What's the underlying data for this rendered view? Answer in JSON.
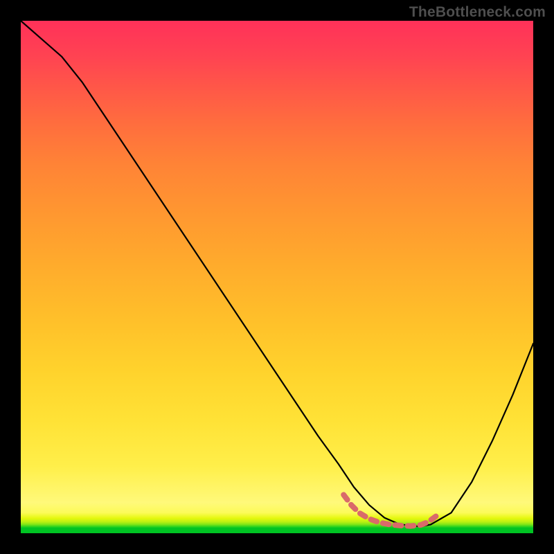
{
  "watermark": "TheBottleneck.com",
  "chart_data": {
    "type": "line",
    "title": "",
    "xlabel": "",
    "ylabel": "",
    "categories": [],
    "x": [
      0.0,
      0.04,
      0.08,
      0.12,
      0.18,
      0.25,
      0.3,
      0.4,
      0.5,
      0.58,
      0.62,
      0.65,
      0.68,
      0.71,
      0.74,
      0.78,
      0.8,
      0.84,
      0.88,
      0.92,
      0.96,
      1.0
    ],
    "values": [
      1.0,
      0.965,
      0.93,
      0.88,
      0.79,
      0.685,
      0.61,
      0.46,
      0.31,
      0.19,
      0.135,
      0.09,
      0.055,
      0.03,
      0.017,
      0.013,
      0.017,
      0.04,
      0.1,
      0.18,
      0.27,
      0.37
    ],
    "xlim": [
      0,
      1
    ],
    "ylim": [
      0,
      1
    ],
    "series": [
      {
        "name": "bottleneck-curve",
        "x": [
          0.0,
          0.04,
          0.08,
          0.12,
          0.18,
          0.25,
          0.3,
          0.4,
          0.5,
          0.58,
          0.62,
          0.65,
          0.68,
          0.71,
          0.74,
          0.78,
          0.8,
          0.84,
          0.88,
          0.92,
          0.96,
          1.0
        ],
        "y": [
          1.0,
          0.965,
          0.93,
          0.88,
          0.79,
          0.685,
          0.61,
          0.46,
          0.31,
          0.19,
          0.135,
          0.09,
          0.055,
          0.03,
          0.017,
          0.013,
          0.017,
          0.04,
          0.1,
          0.18,
          0.27,
          0.37
        ]
      },
      {
        "name": "valley-highlight",
        "x": [
          0.63,
          0.645,
          0.66,
          0.68,
          0.7,
          0.72,
          0.74,
          0.76,
          0.78,
          0.795,
          0.81
        ],
        "y": [
          0.075,
          0.055,
          0.04,
          0.028,
          0.021,
          0.017,
          0.015,
          0.014,
          0.016,
          0.022,
          0.033
        ]
      }
    ],
    "colors": {
      "curve": "#000000",
      "highlight": "#d96a6a"
    }
  }
}
